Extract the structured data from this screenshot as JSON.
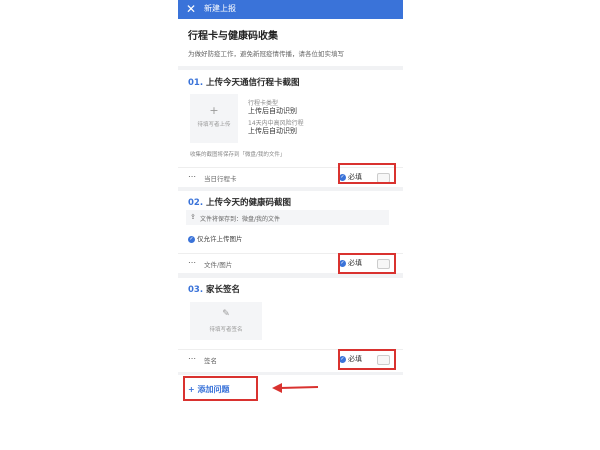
{
  "header": {
    "close_icon": "close-icon",
    "title": "新建上报"
  },
  "form": {
    "title": "行程卡与健康码收集",
    "desc": "为做好防疫工作，避免新冠疫情传播，请各位如实填写"
  },
  "q1": {
    "num": "01.",
    "title": "上传今天通信行程卡截图",
    "upload_plus": "+",
    "upload_label": "待填写者上传",
    "meta1_label": "行程卡类型",
    "meta1_value": "上传后自动识别",
    "meta2_label": "14天内中高风险行程",
    "meta2_value": "上传后自动识别",
    "save_note": "收集的截图将保存到「微盘/我的文件」",
    "footer_label": "当日行程卡",
    "required_label": "必填"
  },
  "q2": {
    "num": "02.",
    "title": "上传今天的健康码截图",
    "save_path": "文件将保存到：微盘/我的文件",
    "only_images": "仅允许上传图片",
    "footer_label": "文件/图片",
    "required_label": "必填"
  },
  "q3": {
    "num": "03.",
    "title": "家长签名",
    "sign_label": "待填写者签名",
    "footer_label": "签名",
    "required_label": "必填"
  },
  "add_question": "+ 添加问题",
  "colors": {
    "accent": "#3a73d9",
    "annotation_red": "#d9322f"
  }
}
